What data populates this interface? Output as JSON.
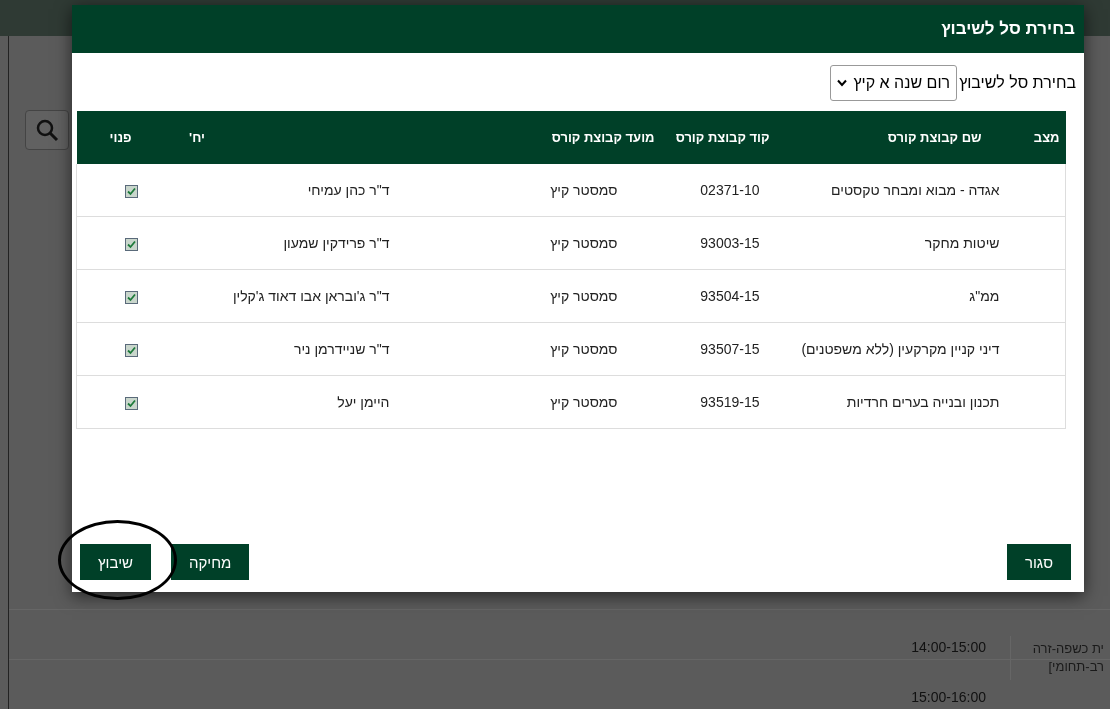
{
  "background": {
    "times": [
      "14:00-15:00",
      "15:00-16:00"
    ],
    "side_texts": [
      "ית כשפה-זרה",
      "רב-תחומי]"
    ]
  },
  "dialog": {
    "title": "בחירת סל לשיבוץ",
    "basket_label": "בחירת סל לשיבוץ",
    "basket_value": "רום שנה א קיץ",
    "table": {
      "columns": [
        "מצב",
        "שם קבוצת קורס",
        "קוד קבוצת קורס",
        "מועד קבוצת קורס",
        "יח'",
        "פנוי"
      ],
      "rows": [
        {
          "name": "אגדה - מבוא ומבחר טקסטים",
          "code": "02371-10",
          "time": "סמסטר קיץ",
          "lecturer": "ד\"ר כהן עמיחי",
          "free": true
        },
        {
          "name": "שיטות מחקר",
          "code": "93003-15",
          "time": "סמסטר קיץ",
          "lecturer": "ד\"ר פרידקין שמעון",
          "free": true
        },
        {
          "name": "ממ\"ג",
          "code": "93504-15",
          "time": "סמסטר קיץ",
          "lecturer": "ד\"ר ג'ובראן אבו דאוד ג'קלין",
          "free": true
        },
        {
          "name": "דיני קניין מקרקעין (ללא משפטנים)",
          "code": "93507-15",
          "time": "סמסטר קיץ",
          "lecturer": "ד\"ר שניידרמן ניר",
          "free": true
        },
        {
          "name": "תכנון ובנייה בערים חרדיות",
          "code": "93519-15",
          "time": "סמסטר קיץ",
          "lecturer": "היימן יעל",
          "free": true
        }
      ]
    },
    "buttons": [
      {
        "kind": "close",
        "label": "סגור"
      },
      {
        "kind": "delete",
        "label": "מחיקה"
      },
      {
        "kind": "assign",
        "label": "שיבוץ",
        "highlighted": true
      }
    ]
  }
}
